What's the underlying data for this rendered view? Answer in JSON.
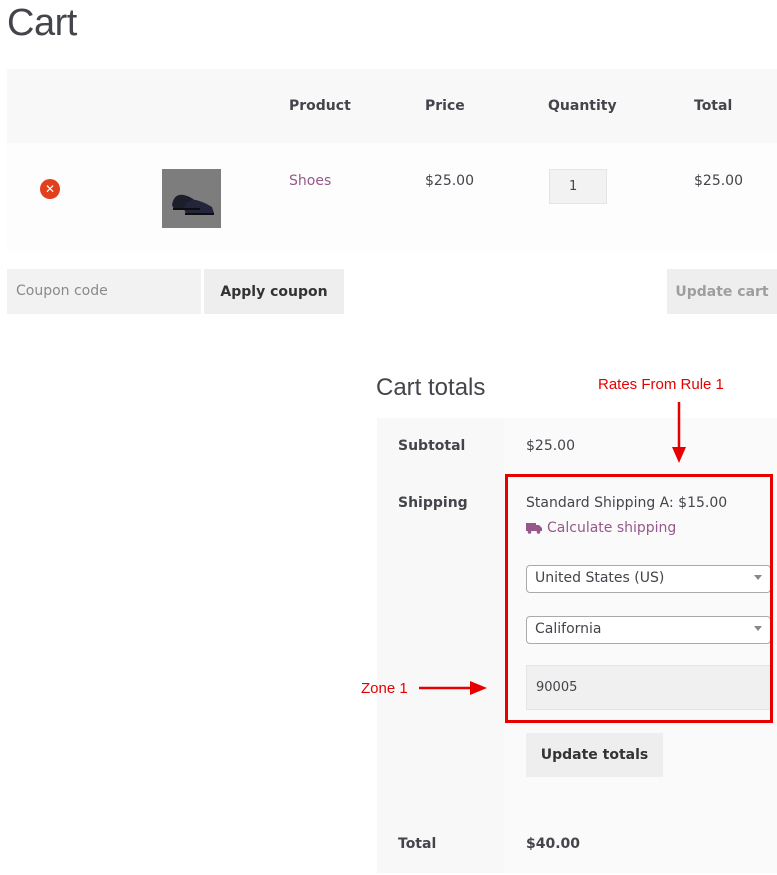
{
  "page": {
    "title": "Cart"
  },
  "table": {
    "headers": {
      "product": "Product",
      "price": "Price",
      "quantity": "Quantity",
      "total": "Total"
    },
    "rows": [
      {
        "product": "Shoes",
        "price": "$25.00",
        "quantity": "1",
        "total": "$25.00"
      }
    ]
  },
  "coupon": {
    "placeholder": "Coupon code",
    "apply_label": "Apply coupon"
  },
  "update_cart_label": "Update cart",
  "totals": {
    "title": "Cart totals",
    "subtotal_label": "Subtotal",
    "subtotal_value": "$25.00",
    "shipping_label": "Shipping",
    "shipping_rate": "Standard Shipping A: $15.00",
    "calculate_shipping": "Calculate shipping",
    "country": "United States (US)",
    "state": "California",
    "postcode": "90005",
    "update_totals_label": "Update totals",
    "total_label": "Total",
    "total_value": "$40.00"
  },
  "annotations": {
    "rates_label": "Rates From Rule 1",
    "zone_label": "Zone 1",
    "color": "#e60000"
  },
  "colors": {
    "link": "#96588a",
    "remove": "#e2401c"
  }
}
